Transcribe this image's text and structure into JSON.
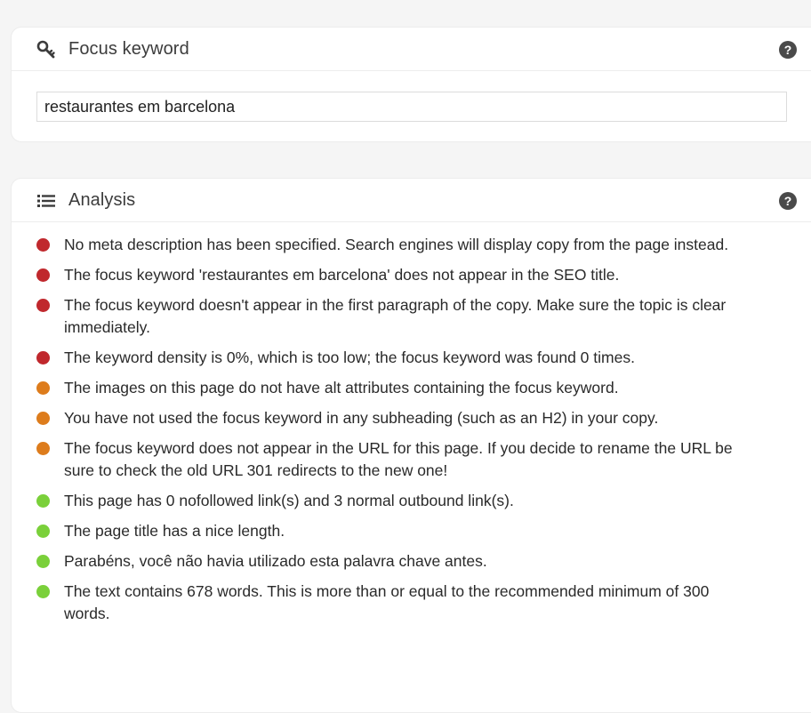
{
  "colors": {
    "bad": "#c0282d",
    "ok": "#dd7c1c",
    "good": "#7ad03a"
  },
  "focus": {
    "icon": "key-icon",
    "title": "Focus keyword",
    "help_icon": "question-circle-icon",
    "help_label": "?",
    "keyword_value": "restaurantes em barcelona"
  },
  "analysis": {
    "icon": "list-icon",
    "title": "Analysis",
    "help_icon": "question-circle-icon",
    "help_label": "?",
    "results": [
      {
        "rating": "bad",
        "text": "No meta description has been specified. Search engines will display copy from the page instead."
      },
      {
        "rating": "bad",
        "text": "The focus keyword 'restaurantes em barcelona' does not appear in the SEO title."
      },
      {
        "rating": "bad",
        "text": "The focus keyword doesn't appear in the first paragraph of the copy. Make sure the topic is clear immediately."
      },
      {
        "rating": "bad",
        "text": "The keyword density is 0%, which is too low; the focus keyword was found 0 times."
      },
      {
        "rating": "ok",
        "text": "The images on this page do not have alt attributes containing the focus keyword."
      },
      {
        "rating": "ok",
        "text": "You have not used the focus keyword in any subheading (such as an H2) in your copy."
      },
      {
        "rating": "ok",
        "text": "The focus keyword does not appear in the URL for this page. If you decide to rename the URL be sure to check the old URL 301 redirects to the new one!"
      },
      {
        "rating": "good",
        "text": "This page has 0 nofollowed link(s) and 3 normal outbound link(s)."
      },
      {
        "rating": "good",
        "text": "The page title has a nice length."
      },
      {
        "rating": "good",
        "text": "Parabéns, você não havia utilizado esta palavra chave antes."
      },
      {
        "rating": "good",
        "text": "The text contains 678 words. This is more than or equal to the recommended minimum of 300 words."
      }
    ]
  }
}
